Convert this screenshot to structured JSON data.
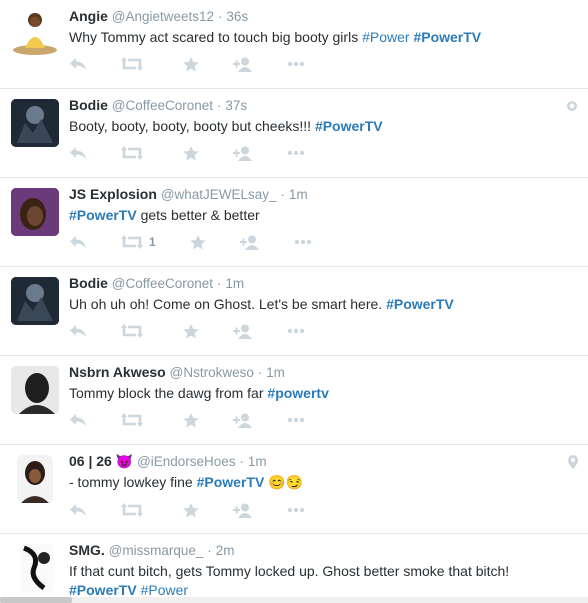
{
  "tweets": [
    {
      "name": "Angie",
      "handle": "@Angietweets12",
      "sep": "·",
      "time": "36s",
      "text": "Why Tommy act scared to touch big booty girls ",
      "tags": [
        "#Power",
        "#PowerTV"
      ],
      "retweets": ""
    },
    {
      "name": "Bodie",
      "handle": "@CoffeeCoronet",
      "sep": "·",
      "time": "37s",
      "text": "Booty, booty, booty, booty but cheeks!!! ",
      "tags": [
        "#PowerTV"
      ],
      "retweets": ""
    },
    {
      "name": "JS Explosion",
      "handle": "@whatJEWELsay_",
      "sep": "·",
      "time": "1m",
      "text": " gets better & better",
      "tags": [
        "#PowerTV"
      ],
      "retweets": "1"
    },
    {
      "name": "Bodie",
      "handle": "@CoffeeCoronet",
      "sep": "·",
      "time": "1m",
      "text": "Uh oh uh oh! Come on Ghost. Let's be smart here. ",
      "tags": [
        "#PowerTV"
      ],
      "retweets": ""
    },
    {
      "name": "Nsbrn Akweso",
      "handle": "@Nstrokweso",
      "sep": "·",
      "time": "1m",
      "text": "Tommy block the dawg from far ",
      "tags": [
        "#powertv"
      ],
      "retweets": ""
    },
    {
      "name": "06 | 26 😈",
      "handle": "@iEndorseHoes",
      "sep": "·",
      "time": "1m",
      "text": "- tommy lowkey fine ",
      "tags": [
        "#PowerTV"
      ],
      "emoji": "😊😏",
      "retweets": ""
    },
    {
      "name": "SMG.",
      "handle": "@missmarque_",
      "sep": "·",
      "time": "2m",
      "text": "If that cunt bitch, gets Tommy locked up. Ghost better smoke that bitch!",
      "tags": [
        "#PowerTV",
        "#Power"
      ],
      "retweets": ""
    }
  ],
  "icons": {
    "reply": "reply-icon",
    "retweet": "retweet-icon",
    "favorite": "star-icon",
    "follow": "follow-icon",
    "more": "more-icon"
  },
  "colors": {
    "link": "#2b7bb9",
    "muted": "#8899a6",
    "action": "#ccd6dd",
    "border": "#e1e8ed"
  }
}
